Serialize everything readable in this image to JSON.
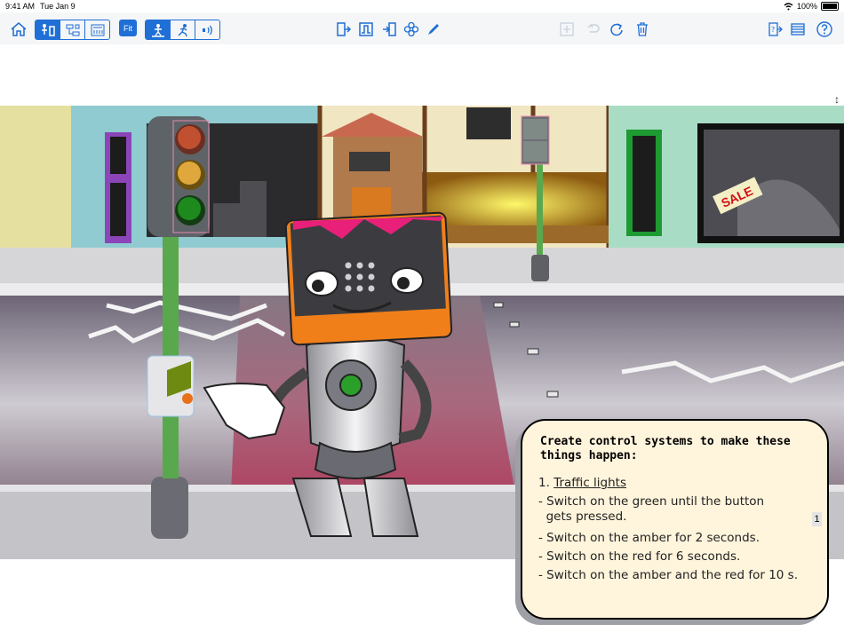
{
  "status_bar": {
    "time": "9:41 AM",
    "date": "Tue Jan 9",
    "battery": "100%"
  },
  "toolbar": {
    "home_icon": "house-icon",
    "view_modes": [
      "scene-view-icon",
      "flowchart-view-icon",
      "mimic-view-icon"
    ],
    "fit_label": "Fit",
    "inputs": [
      "pedestrian-crossing-icon",
      "running-person-icon",
      "sound-sensor-icon"
    ],
    "tools": [
      "output-icon",
      "pulse-icon",
      "input-icon",
      "flower-icon",
      "pen-icon"
    ],
    "edit": [
      "add-icon",
      "undo-icon",
      "redo-icon",
      "trash-icon"
    ],
    "right": [
      "help-icon",
      "list-icon",
      "question-icon"
    ]
  },
  "sign": {
    "text": "SALE"
  },
  "panel": {
    "heading": "Create control systems to make these things happen:",
    "item_number": "1.",
    "item_title": "Traffic lights",
    "lines": [
      "- Switch on the green until the button",
      "  gets pressed.",
      "- Switch on the amber for 2 seconds.",
      "- Switch on the red for 6 seconds.",
      "- Switch on the amber and the red for 10 s."
    ]
  },
  "page_number": "1",
  "colors": {
    "accent": "#1f6fd6",
    "panel_bg": "#fff4dc",
    "road": "#7d6f82",
    "pole": "#5aa84e"
  }
}
